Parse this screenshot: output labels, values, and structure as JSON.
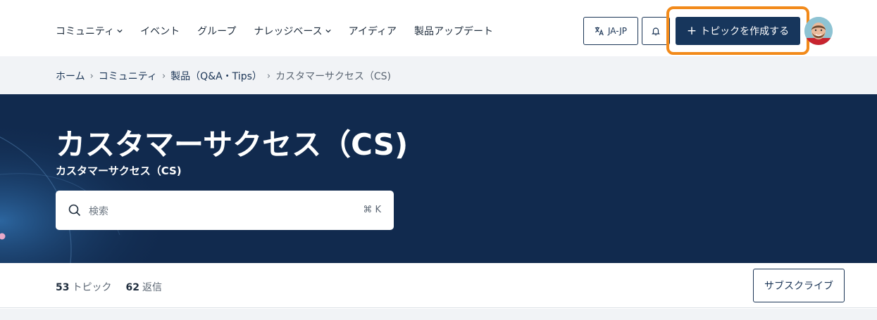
{
  "nav": {
    "items": [
      {
        "label": "コミュニティ",
        "has_dropdown": true
      },
      {
        "label": "イベント",
        "has_dropdown": false
      },
      {
        "label": "グループ",
        "has_dropdown": false
      },
      {
        "label": "ナレッジベース",
        "has_dropdown": true
      },
      {
        "label": "アイディア",
        "has_dropdown": false
      },
      {
        "label": "製品アップデート",
        "has_dropdown": false
      }
    ],
    "language": "JA-JP",
    "create_topic": "トピックを作成する",
    "icons": {
      "language": "translate-icon",
      "bell": "bell-icon",
      "plus": "plus-icon"
    }
  },
  "breadcrumb": [
    "ホーム",
    "コミュニティ",
    "製品（Q&A・Tips）",
    "カスタマーサクセス（CS)"
  ],
  "hero": {
    "title": "カスタマーサクセス（CS)",
    "subtitle": "カスタマーサクセス（CS)",
    "search_placeholder": "検索",
    "search_shortcut": "⌘ K"
  },
  "stats": {
    "topics_count": "53",
    "topics_label": "トピック",
    "replies_count": "62",
    "replies_label": "返信"
  },
  "subscribe": "サブスクライブ",
  "colors": {
    "primary": "#17365c",
    "hero_bg": "#112a4e",
    "highlight": "#f28a1a",
    "crumb_bg": "#f1f3f6"
  }
}
